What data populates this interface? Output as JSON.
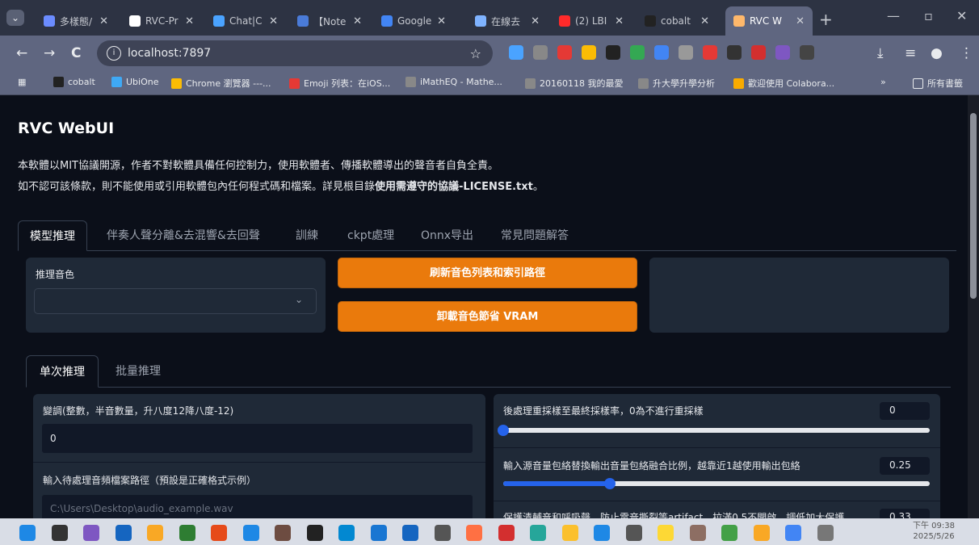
{
  "browser": {
    "tabs": [
      {
        "title": "多樣態/",
        "color": "#6b8cff"
      },
      {
        "title": "RVC-Pr",
        "color": "#ffffff"
      },
      {
        "title": "Chat|C",
        "color": "#4aa3ff"
      },
      {
        "title": "【Note",
        "color": "#4a7bd8"
      },
      {
        "title": "Google",
        "color": "#4285f4"
      },
      {
        "title": "在線去",
        "color": "#7fb3ff"
      },
      {
        "title": "(2) LBI",
        "color": "#ff2a2a"
      },
      {
        "title": "cobalt",
        "color": "#222222"
      },
      {
        "title": "RVC W",
        "color": "#ffb86b"
      }
    ],
    "new_tab": "+",
    "win_min": "—",
    "win_max": "▫",
    "win_close": "✕",
    "url": "localhost:7897",
    "nav_back": "←",
    "nav_forward": "→",
    "nav_reload": "C",
    "bookmarks": [
      {
        "label": "cobalt",
        "color": "#222"
      },
      {
        "label": "UbiOne",
        "color": "#3fa9f5"
      },
      {
        "label": "Chrome 瀏覽器 ---...",
        "color": "#fbbc05"
      },
      {
        "label": "Emoji 列表：在iOS...",
        "color": "#e53935"
      },
      {
        "label": "iMathEQ - Mathe...",
        "color": "#888"
      },
      {
        "label": "20160118 我的最愛",
        "color": "#888"
      },
      {
        "label": "升大學升學分析",
        "color": "#888"
      },
      {
        "label": "歡迎使用 Colabora...",
        "color": "#f9ab00"
      }
    ],
    "bookmarks_more": "»",
    "all_bookmarks": "所有書籤"
  },
  "app": {
    "title": "RVC WebUI",
    "desc_line1": "本軟體以MIT協議開源，作者不對軟體具備任何控制力，使用軟體者、傳播軟體導出的聲音者自負全責。",
    "desc_line2_pre": "如不認可該條款，則不能使用或引用軟體包內任何程式碼和檔案。詳見根目錄",
    "desc_line2_bold": "使用需遵守的協議-LICENSE.txt",
    "desc_line2_post": "。",
    "main_tabs": [
      "模型推理",
      "伴奏人聲分離&去混響&去回聲",
      "訓練",
      "ckpt處理",
      "Onnx导出",
      "常見問題解答"
    ],
    "voice_label": "推理音色",
    "voice_value": "",
    "refresh_button": "刷新音色列表和索引路徑",
    "unload_button": "卸載音色節省 VRAM",
    "sub_tabs": [
      "单次推理",
      "批量推理"
    ],
    "transpose_label": "變調(整數，半音數量，升八度12降八度-12)",
    "transpose_value": "0",
    "audio_path_label": "輸入待處理音頻檔案路徑（預設是正確格式示例）",
    "audio_path_placeholder": "C:\\Users\\Desktop\\audio_example.wav",
    "resample_label": "後處理重採樣至最終採樣率，0為不進行重採樣",
    "resample_value": "0",
    "resample_level": 0,
    "rms_label": "輸入源音量包絡替換輸出音量包絡融合比例，越靠近1越使用輸出包絡",
    "rms_value": "0.25",
    "rms_level": 0.25,
    "protect_label": "保護清輔音和呼吸聲，防止電音撕裂等artifact，拉滿0.5不開啟，調低加大保護",
    "protect_value": "0.33"
  },
  "taskbar": {
    "time": "下午 09:38",
    "date": "2025/5/26",
    "icons": [
      "windows-icon",
      "search-icon",
      "copilot-icon",
      "store-icon",
      "explorer-icon",
      "excel-icon",
      "powerpoint-icon",
      "app-icon",
      "network-icon",
      "cobalt-icon",
      "edge-icon",
      "shield-icon",
      "word-icon",
      "font-icon",
      "matlab-icon",
      "app2-icon",
      "app3-icon",
      "chrome-icon",
      "app4-icon",
      "app5-icon",
      "app6-icon",
      "app7-icon",
      "line-icon",
      "app8-icon",
      "chrome2-icon",
      "more-icon"
    ],
    "icon_colors": [
      "#1e88e5",
      "#333",
      "#7e57c2",
      "#1565c0",
      "#f9a825",
      "#2e7d32",
      "#e64a19",
      "#1e88e5",
      "#6d4c41",
      "#222",
      "#0288d1",
      "#1976d2",
      "#1565c0",
      "#555",
      "#ff7043",
      "#d32f2f",
      "#26a69a",
      "#fbc02d",
      "#1e88e5",
      "#555",
      "#fdd835",
      "#8d6e63",
      "#43a047",
      "#f9a825",
      "#4285f4",
      "#777"
    ]
  }
}
